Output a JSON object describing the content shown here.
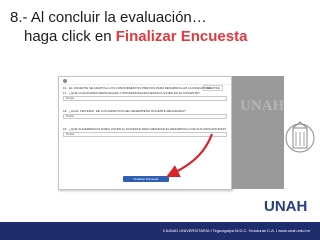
{
  "slide": {
    "title_line1": "8.- Al concluir la evaluación…",
    "title_line2_prefix": "haga click en ",
    "title_line2_highlight": "Finalizar Encuesta"
  },
  "screenshot": {
    "select_value": "SIEMPRE",
    "rows": [
      {
        "num": "16.",
        "text": "EL DOCENTE SE ADAPTA A LOS CONOCIMIENTOS PREVIOS PARA DESARROLLAR LA ASIGNATURA",
        "value": ""
      },
      {
        "num": "17.",
        "text": "¿QUE CUALIDADES PERSONALES Y PROFESIONALES DESTACA USTED EN EL DOCENTE?",
        "value": "Prueba"
      },
      {
        "num": "18.",
        "text": "¿CUAL CRITERIO, DE LOS ASPECTOS DEL DESEMPEÑO DOCENTE MEJORARIA?",
        "value": "Prueba"
      },
      {
        "num": "19.",
        "text": "¿QUE SUGERENCIAS DARIA USTED AL DOCENTE PARA MEJORAR EL DESARROLLO DE SUS ASIGNATURAS?",
        "value": "Prueba"
      }
    ],
    "submit_label": "Finalizar Encuesta"
  },
  "side_text": "UNAH",
  "footer": "CIUDAD UNIVERSITARIA  I  Tegucigalpa M.D.C. Honduras C.A.  I  www.unah.edu.hn",
  "colors": {
    "highlight": "#e0393f",
    "arrow": "#d8232a",
    "footer_bg": "#1f2d6d",
    "brand": "#2a3d82"
  }
}
